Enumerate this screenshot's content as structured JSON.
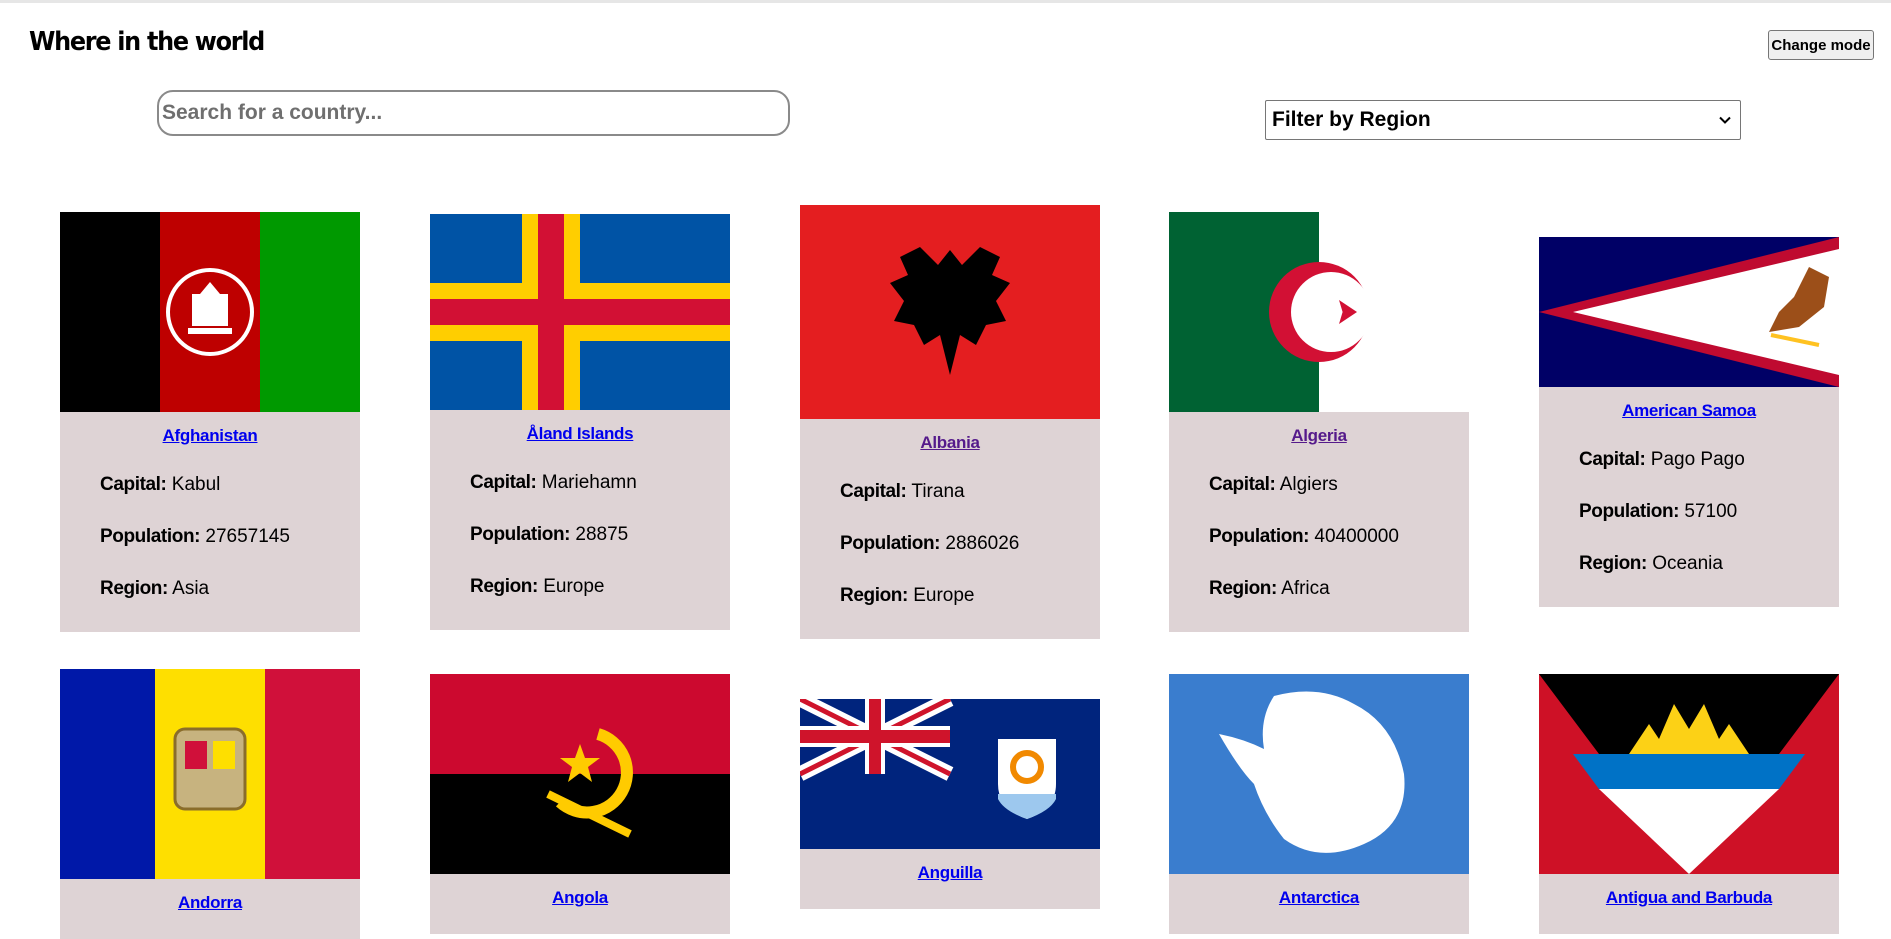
{
  "header": {
    "title": "Where in the world",
    "mode_button": "Change mode"
  },
  "search": {
    "placeholder": "Search for a country..."
  },
  "filter": {
    "selected": "Filter by Region"
  },
  "labels": {
    "capital": "Capital:",
    "population": "Population:",
    "region": "Region:"
  },
  "countries": [
    {
      "name": "Afghanistan",
      "capital": "Kabul",
      "population": "27657145",
      "region": "Asia",
      "flag": "afghanistan-flag"
    },
    {
      "name": "Åland Islands",
      "capital": "Mariehamn",
      "population": "28875",
      "region": "Europe",
      "flag": "aland-islands-flag"
    },
    {
      "name": "Albania",
      "capital": "Tirana",
      "population": "2886026",
      "region": "Europe",
      "flag": "albania-flag"
    },
    {
      "name": "Algeria",
      "capital": "Algiers",
      "population": "40400000",
      "region": "Africa",
      "flag": "algeria-flag"
    },
    {
      "name": "American Samoa",
      "capital": "Pago Pago",
      "population": "57100",
      "region": "Oceania",
      "flag": "american-samoa-flag"
    },
    {
      "name": "Andorra",
      "flag": "andorra-flag"
    },
    {
      "name": "Angola",
      "flag": "angola-flag"
    },
    {
      "name": "Anguilla",
      "flag": "anguilla-flag"
    },
    {
      "name": "Antarctica",
      "flag": "antarctica-flag"
    },
    {
      "name": "Antigua and Barbuda",
      "flag": "antigua-and-barbuda-flag"
    }
  ],
  "colors": {
    "card_background": "#ded3d5",
    "link": "#0000ee",
    "link_visited": "#551a8b"
  }
}
